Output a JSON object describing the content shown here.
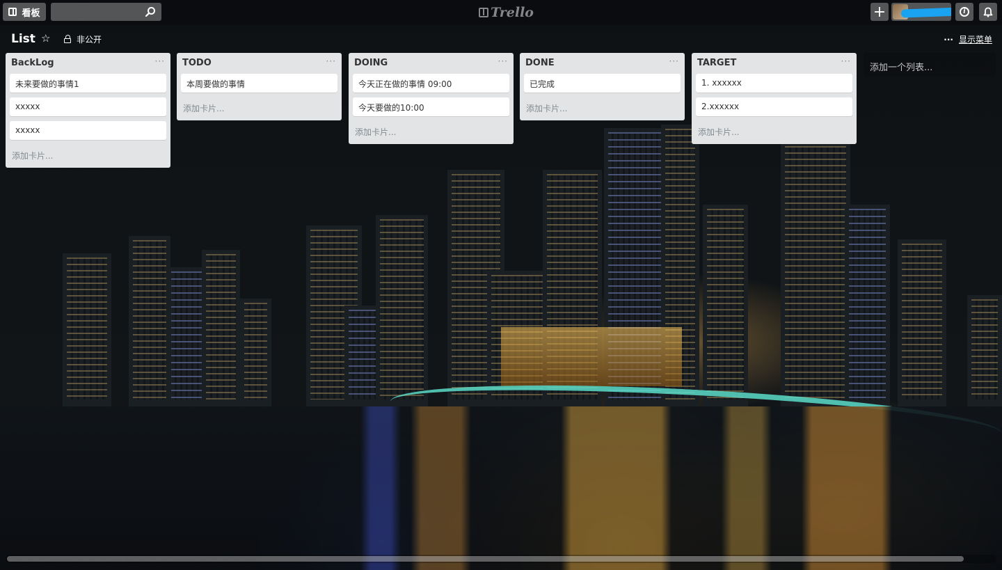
{
  "header": {
    "boards_label": "看板",
    "search_placeholder": "",
    "logo_text": "Trello",
    "add_label": "+"
  },
  "board": {
    "title": "List",
    "privacy": "非公开",
    "show_menu": "显示菜单",
    "show_menu_dots": "···"
  },
  "lists": [
    {
      "title": "BackLog",
      "menu": "···",
      "cards": [
        "未来要做的事情1",
        "xxxxx",
        "xxxxx"
      ],
      "add_card": "添加卡片..."
    },
    {
      "title": "TODO",
      "menu": "···",
      "cards": [
        "本周要做的事情"
      ],
      "add_card": "添加卡片..."
    },
    {
      "title": "DOING",
      "menu": "···",
      "cards": [
        "今天正在做的事情 09:00",
        "今天要做的10:00"
      ],
      "add_card": "添加卡片..."
    },
    {
      "title": "DONE",
      "menu": "···",
      "cards": [
        "已完成"
      ],
      "add_card": "添加卡片..."
    },
    {
      "title": "TARGET",
      "menu": "···",
      "cards": [
        "1. xxxxxx",
        "2.xxxxxx"
      ],
      "add_card": "添加卡片..."
    }
  ],
  "add_list": "添加一个列表...",
  "colors": {
    "list_bg": "#e2e4e6",
    "card_bg": "#ffffff",
    "redaction": "#1aa3f0"
  }
}
